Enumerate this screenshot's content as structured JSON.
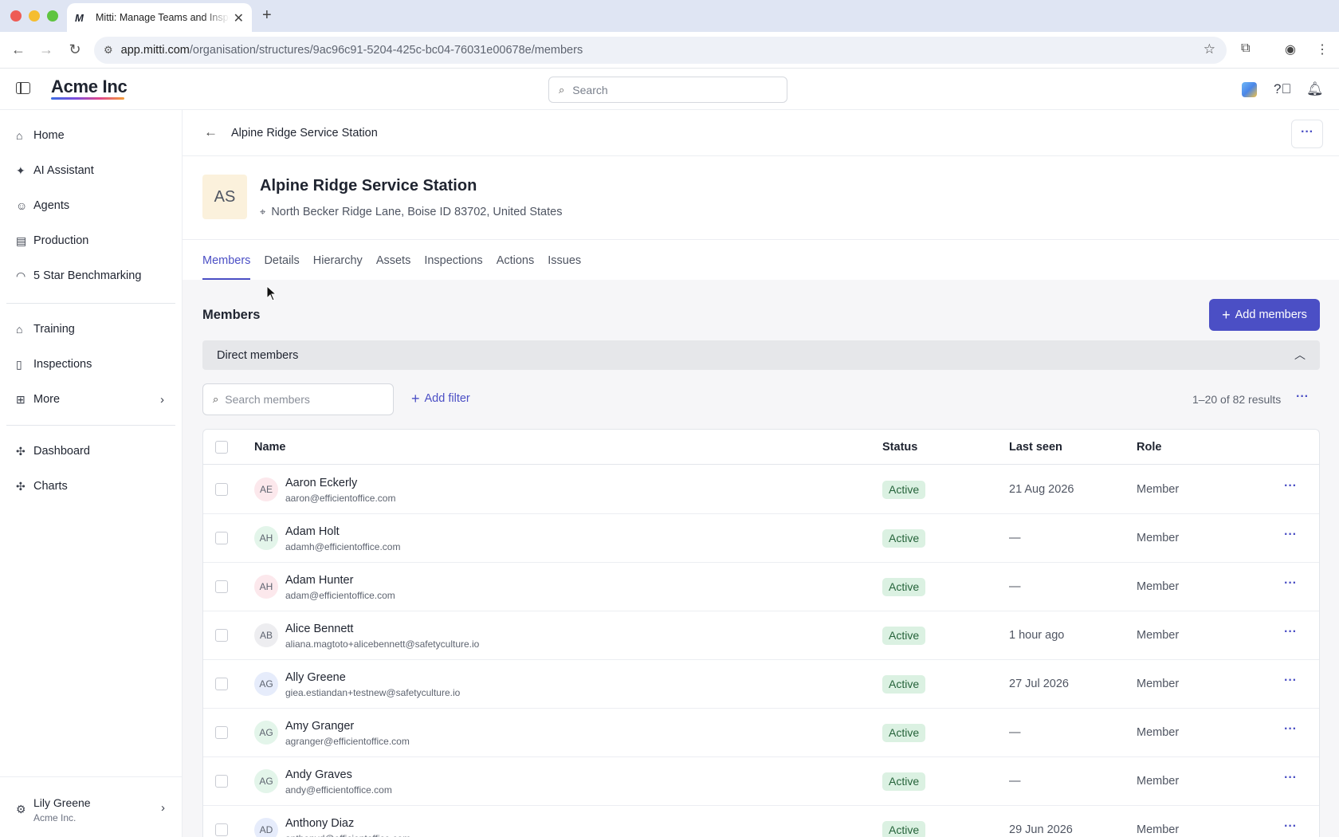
{
  "browser": {
    "tab_title": "Mitti: Manage Teams and Inspections",
    "tab_favicon": "M",
    "url_host": "app.mitti.com",
    "url_path": "/organisation/structures/9ac96c91-5204-425c-bc04-76031e00678e/members"
  },
  "header": {
    "brand": "Acme Inc",
    "search_placeholder": "Search"
  },
  "sidebar": {
    "items": [
      {
        "label": "Home",
        "icon": "home-icon"
      },
      {
        "label": "AI Assistant",
        "icon": "sparkle-icon"
      },
      {
        "label": "Agents",
        "icon": "robot-icon"
      },
      {
        "label": "Production",
        "icon": "building-icon"
      },
      {
        "label": "5 Star Benchmarking",
        "icon": "gauge-icon"
      },
      {
        "label": "Training",
        "icon": "graduation-cap-icon"
      },
      {
        "label": "Inspections",
        "icon": "clipboard-icon"
      },
      {
        "label": "More",
        "icon": "grid-icon"
      },
      {
        "label": "Dashboard",
        "icon": "puzzle-icon"
      },
      {
        "label": "Charts",
        "icon": "puzzle-icon"
      }
    ],
    "user": {
      "name": "Lily Greene",
      "org": "Acme Inc."
    }
  },
  "page": {
    "breadcrumb_title": "Alpine Ridge Service Station",
    "avatar_initials": "AS",
    "title": "Alpine Ridge Service Station",
    "address": "North Becker Ridge Lane, Boise ID 83702, United States",
    "tabs": [
      "Members",
      "Details",
      "Hierarchy",
      "Assets",
      "Inspections",
      "Actions",
      "Issues"
    ],
    "active_tab": "Members"
  },
  "members": {
    "heading": "Members",
    "add_button": "Add members",
    "section_label": "Direct members",
    "search_placeholder": "Search members",
    "add_filter": "Add filter",
    "results": "1–20 of 82 results",
    "columns": {
      "name": "Name",
      "status": "Status",
      "last_seen": "Last seen",
      "role": "Role"
    },
    "rows": [
      {
        "initials": "AE",
        "name": "Aaron Eckerly",
        "email": "aaron@efficientoffice.com",
        "status": "Active",
        "last_seen": "21 Aug 2026",
        "role": "Member",
        "avatar_color": "#fce8ec"
      },
      {
        "initials": "AH",
        "name": "Adam Holt",
        "email": "adamh@efficientoffice.com",
        "status": "Active",
        "last_seen": "—",
        "role": "Member",
        "avatar_color": "#e3f5ea"
      },
      {
        "initials": "AH",
        "name": "Adam Hunter",
        "email": "adam@efficientoffice.com",
        "status": "Active",
        "last_seen": "—",
        "role": "Member",
        "avatar_color": "#fce8ec"
      },
      {
        "initials": "AB",
        "name": "Alice Bennett",
        "email": "aliana.magtoto+alicebennett@safetyculture.io",
        "status": "Active",
        "last_seen": "1 hour ago",
        "role": "Member",
        "avatar_color": "#ededf0"
      },
      {
        "initials": "AG",
        "name": "Ally Greene",
        "email": "giea.estiandan+testnew@safetyculture.io",
        "status": "Active",
        "last_seen": "27 Jul 2026",
        "role": "Member",
        "avatar_color": "#e6ecfb"
      },
      {
        "initials": "AG",
        "name": "Amy Granger",
        "email": "agranger@efficientoffice.com",
        "status": "Active",
        "last_seen": "—",
        "role": "Member",
        "avatar_color": "#e3f5ea"
      },
      {
        "initials": "AG",
        "name": "Andy Graves",
        "email": "andy@efficientoffice.com",
        "status": "Active",
        "last_seen": "—",
        "role": "Member",
        "avatar_color": "#e3f5ea"
      },
      {
        "initials": "AD",
        "name": "Anthony Diaz",
        "email": "anthonyd@efficientoffice.com",
        "status": "Active",
        "last_seen": "29 Jun 2026",
        "role": "Member",
        "avatar_color": "#e6ecfb"
      }
    ]
  }
}
